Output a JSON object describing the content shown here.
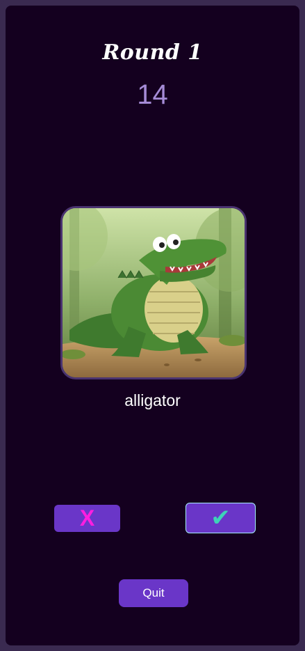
{
  "round": {
    "title": "Round 1"
  },
  "timer": {
    "value": "14"
  },
  "card": {
    "image_subject": "cartoon alligator",
    "word": "alligator"
  },
  "controls": {
    "wrong_label": "X",
    "right_label": "✔",
    "quit_label": "Quit"
  },
  "colors": {
    "page_background": "#14001f",
    "frame": "#3a2a50",
    "accent": "#6a36c8",
    "timer": "#a58bd6",
    "wrong_glyph": "#ff1ee0",
    "right_glyph": "#3ed2b8"
  }
}
